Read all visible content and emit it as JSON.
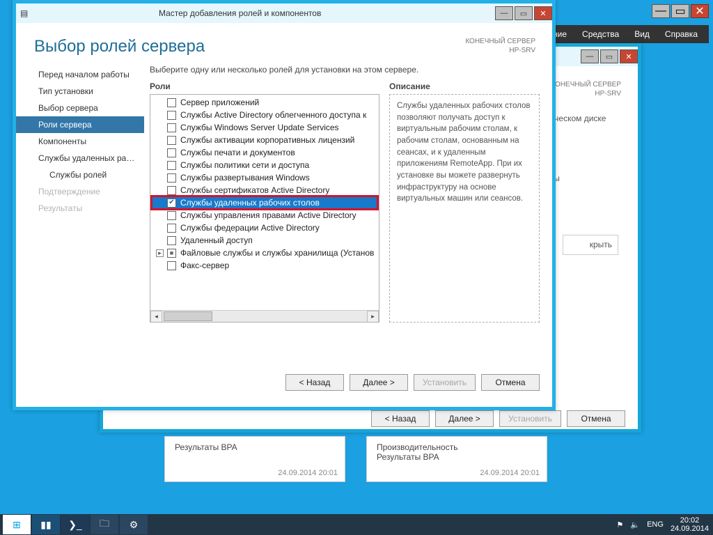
{
  "menubar": {
    "items": [
      "ение",
      "Средства",
      "Вид",
      "Справка"
    ]
  },
  "front": {
    "title": "Мастер добавления ролей и компонентов",
    "header": "Выбор ролей сервера",
    "server_label": "КОНЕЧНЫЙ СЕРВЕР",
    "server_name": "HP-SRV",
    "intro": "Выберите одну или несколько ролей для установки на этом сервере.",
    "roles_label": "Роли",
    "desc_label": "Описание",
    "nav": [
      {
        "label": "Перед началом работы",
        "active": false
      },
      {
        "label": "Тип установки",
        "active": false
      },
      {
        "label": "Выбор сервера",
        "active": false
      },
      {
        "label": "Роли сервера",
        "active": true
      },
      {
        "label": "Компоненты",
        "active": false
      },
      {
        "label": "Службы удаленных рабо...",
        "active": false
      },
      {
        "label": "Службы ролей",
        "active": false,
        "sub": true
      },
      {
        "label": "Подтверждение",
        "active": false,
        "disabled": true
      },
      {
        "label": "Результаты",
        "active": false,
        "disabled": true
      }
    ],
    "roles": [
      {
        "label": "Сервер приложений"
      },
      {
        "label": "Службы Active Directory облегченного доступа к"
      },
      {
        "label": "Службы Windows Server Update Services"
      },
      {
        "label": "Службы активации корпоративных лицензий"
      },
      {
        "label": "Службы печати и документов"
      },
      {
        "label": "Службы политики сети и доступа"
      },
      {
        "label": "Службы развертывания Windows"
      },
      {
        "label": "Службы сертификатов Active Directory"
      },
      {
        "label": "Службы удаленных рабочих столов",
        "checked": true,
        "selected": true,
        "highlight": true
      },
      {
        "label": "Службы управления правами Active Directory"
      },
      {
        "label": "Службы федерации Active Directory"
      },
      {
        "label": "Удаленный доступ"
      },
      {
        "label": "Файловые службы и службы хранилища (Установ",
        "indet": true,
        "exp": true
      },
      {
        "label": "Факс-сервер"
      }
    ],
    "description": "Службы удаленных рабочих столов позволяют получать доступ к виртуальным рабочим столам, к рабочим столам, основанным на сеансах, и к удаленным приложениям RemoteApp. При их установке вы можете развернуть инфраструктуру на основе виртуальных машин или сеансов.",
    "buttons": {
      "back": "< Назад",
      "next": "Далее >",
      "install": "Установить",
      "cancel": "Отмена"
    }
  },
  "back": {
    "server_label": "КОНЕЧНЫЙ СЕРВЕР",
    "server_name": "HP-SRV",
    "frag1": "щем физическом диске (VHD).",
    "frag2": "VDI), чтобы",
    "frag3": "крыть",
    "buttons": {
      "back": "< Назад",
      "next": "Далее >",
      "install": "Установить",
      "cancel": "Отмена"
    }
  },
  "panels": {
    "left": {
      "line1": "Результаты BPA",
      "ts": "24.09.2014 20:01"
    },
    "right": {
      "line1": "Производительность",
      "line2": "Результаты BPA",
      "ts": "24.09.2014 20:01"
    }
  },
  "tray": {
    "lang": "ENG",
    "flag": "🏳️",
    "sound": "🔈",
    "time": "20:02",
    "date": "24.09.2014"
  }
}
